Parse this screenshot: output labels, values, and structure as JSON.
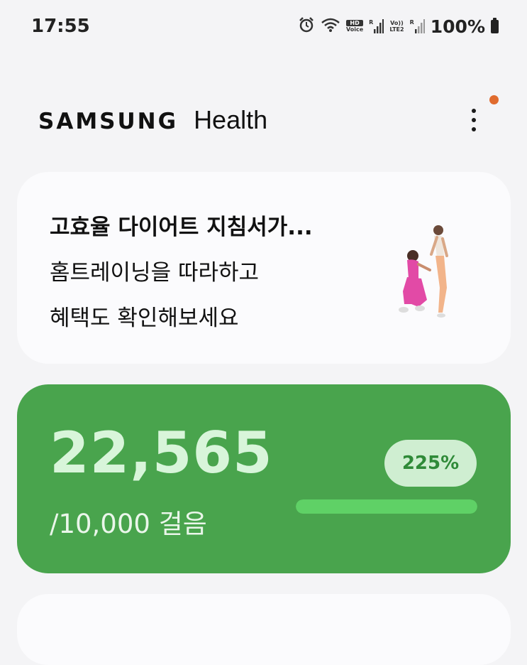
{
  "status_bar": {
    "time": "17:55",
    "hd_voice_top": "HD",
    "hd_voice_bottom": "Voice",
    "roaming_1": "R",
    "volte_top": "Vo))",
    "volte_bottom": "LTE2",
    "roaming_2": "R",
    "battery": "100%",
    "icons": [
      "alarm-icon",
      "wifi-icon",
      "signal-icon",
      "signal-icon",
      "battery-icon"
    ]
  },
  "header": {
    "brand_samsung": "SAMSUNG",
    "brand_health": "Health",
    "menu_icon": "more-vert-icon",
    "notification_color": "#e06b2e"
  },
  "promo": {
    "title": "고효율 다이어트 지침서가...",
    "line1": "홈트레이닝을 따라하고",
    "line2": "혜택도 확인해보세요"
  },
  "steps": {
    "count": "22,565",
    "goal": "/10,000 걸음",
    "percent": "225%",
    "progress": 1.0,
    "card_color": "#49a44d"
  }
}
